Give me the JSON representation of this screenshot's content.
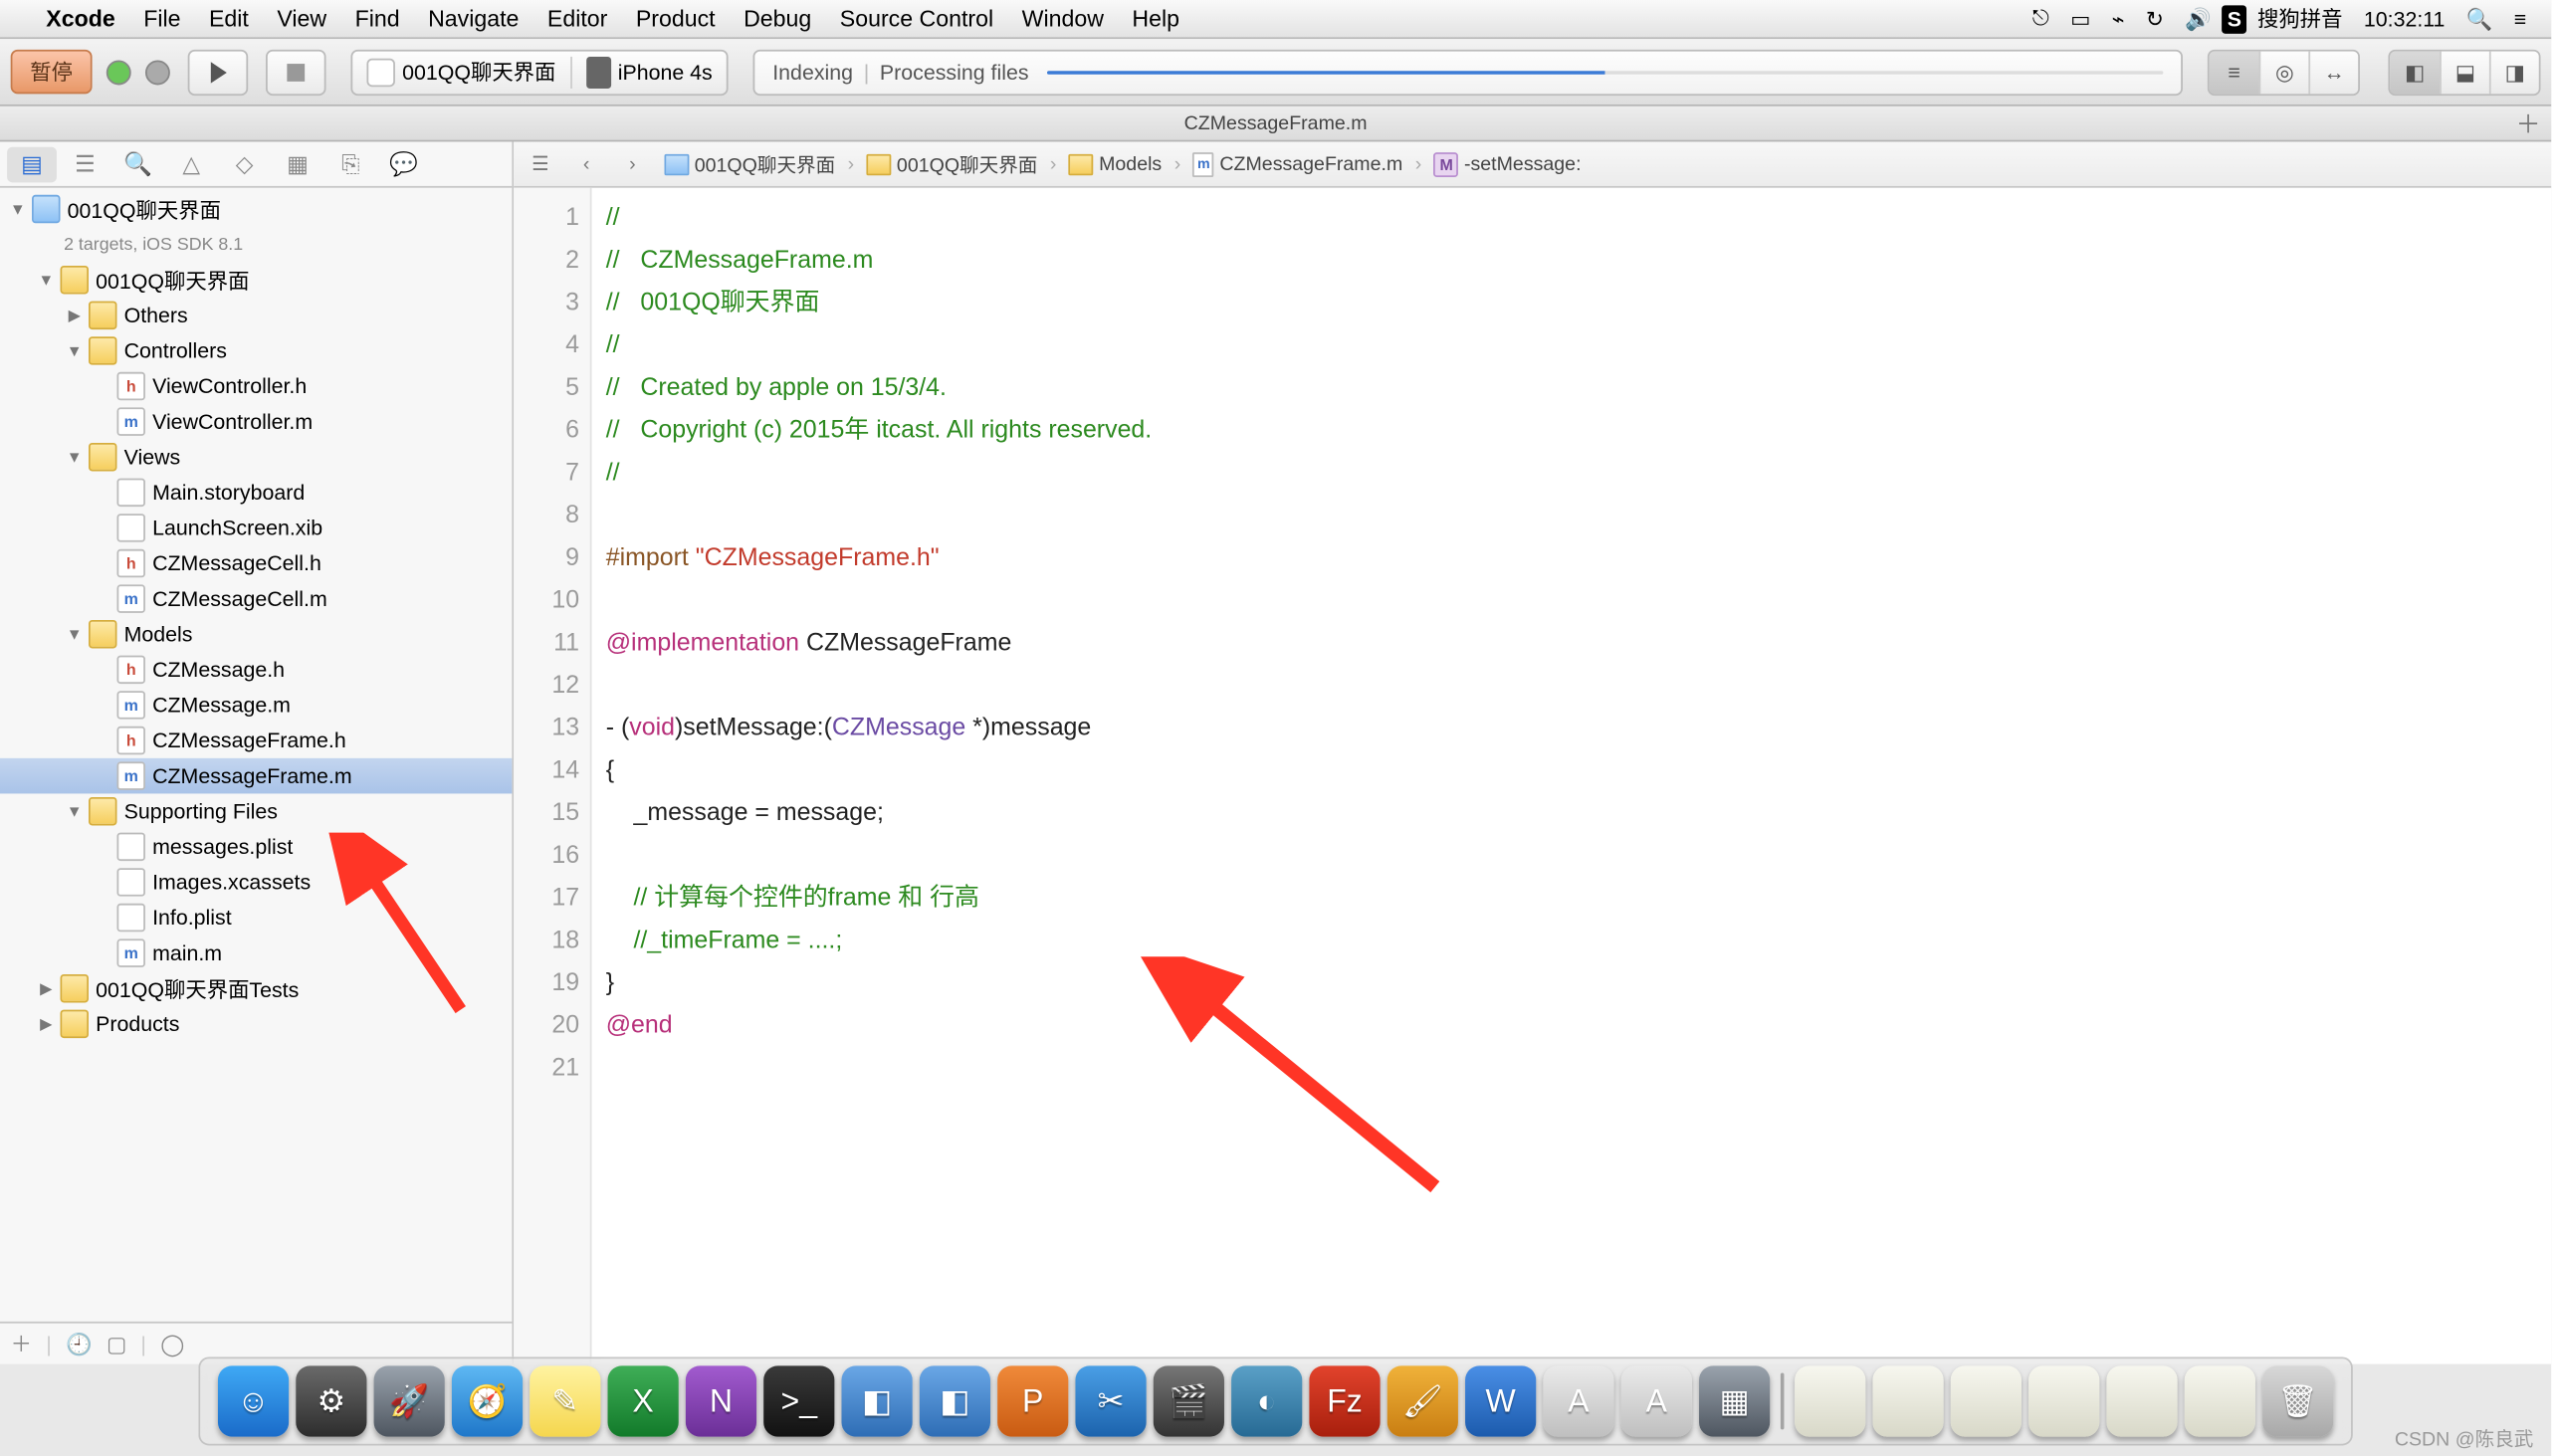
{
  "menu": {
    "appName": "Xcode",
    "items": [
      "File",
      "Edit",
      "View",
      "Find",
      "Navigate",
      "Editor",
      "Product",
      "Debug",
      "Source Control",
      "Window",
      "Help"
    ],
    "right": {
      "ime": "搜狗拼音",
      "time": "10:32:11"
    }
  },
  "toolbar": {
    "pause": "暂停",
    "scheme": {
      "app": "001QQ聊天界面",
      "device": "iPhone 4s"
    },
    "activity": {
      "status": "Indexing",
      "separator": "|",
      "sub": "Processing files"
    }
  },
  "tabbar": {
    "title": "CZMessageFrame.m"
  },
  "navigator": {
    "project": {
      "name": "001QQ聊天界面",
      "subtitle": "2 targets, iOS SDK 8.1"
    },
    "tree": [
      {
        "level": 0,
        "type": "project",
        "label": "001QQ聊天界面",
        "open": true,
        "subtitle": "2 targets, iOS SDK 8.1"
      },
      {
        "level": 1,
        "type": "folder-y",
        "label": "001QQ聊天界面",
        "open": true
      },
      {
        "level": 2,
        "type": "folder-y",
        "label": "Others",
        "open": false,
        "arrow": true
      },
      {
        "level": 2,
        "type": "folder-y",
        "label": "Controllers",
        "open": true
      },
      {
        "level": 3,
        "type": "h",
        "label": "ViewController.h"
      },
      {
        "level": 3,
        "type": "m",
        "label": "ViewController.m"
      },
      {
        "level": 2,
        "type": "folder-y",
        "label": "Views",
        "open": true
      },
      {
        "level": 3,
        "type": "xib",
        "label": "Main.storyboard"
      },
      {
        "level": 3,
        "type": "xib",
        "label": "LaunchScreen.xib"
      },
      {
        "level": 3,
        "type": "h",
        "label": "CZMessageCell.h"
      },
      {
        "level": 3,
        "type": "m",
        "label": "CZMessageCell.m"
      },
      {
        "level": 2,
        "type": "folder-y",
        "label": "Models",
        "open": true
      },
      {
        "level": 3,
        "type": "h",
        "label": "CZMessage.h"
      },
      {
        "level": 3,
        "type": "m",
        "label": "CZMessage.m"
      },
      {
        "level": 3,
        "type": "h",
        "label": "CZMessageFrame.h"
      },
      {
        "level": 3,
        "type": "m",
        "label": "CZMessageFrame.m",
        "selected": true
      },
      {
        "level": 2,
        "type": "folder-y",
        "label": "Supporting Files",
        "open": true
      },
      {
        "level": 3,
        "type": "xib",
        "label": "messages.plist"
      },
      {
        "level": 3,
        "type": "xib",
        "label": "Images.xcassets"
      },
      {
        "level": 3,
        "type": "xib",
        "label": "Info.plist"
      },
      {
        "level": 3,
        "type": "m",
        "label": "main.m"
      },
      {
        "level": 1,
        "type": "folder-y",
        "label": "001QQ聊天界面Tests",
        "open": false,
        "arrow": true
      },
      {
        "level": 1,
        "type": "folder-y",
        "label": "Products",
        "open": false,
        "arrow": true
      }
    ]
  },
  "jumpbar": {
    "items": [
      "001QQ聊天界面",
      "001QQ聊天界面",
      "Models",
      "CZMessageFrame.m",
      "-setMessage:"
    ]
  },
  "code": {
    "lines": [
      [
        {
          "c": "c-comment",
          "t": "//"
        }
      ],
      [
        {
          "c": "c-comment",
          "t": "//   CZMessageFrame.m"
        }
      ],
      [
        {
          "c": "c-comment",
          "t": "//   001QQ聊天界面"
        }
      ],
      [
        {
          "c": "c-comment",
          "t": "//"
        }
      ],
      [
        {
          "c": "c-comment",
          "t": "//   Created by apple on 15/3/4."
        }
      ],
      [
        {
          "c": "c-comment",
          "t": "//   Copyright (c) 2015年 itcast. All rights reserved."
        }
      ],
      [
        {
          "c": "c-comment",
          "t": "//"
        }
      ],
      [
        {
          "c": "c-plain",
          "t": ""
        }
      ],
      [
        {
          "c": "c-pre",
          "t": "#import "
        },
        {
          "c": "c-string",
          "t": "\"CZMessageFrame.h\""
        }
      ],
      [
        {
          "c": "c-plain",
          "t": ""
        }
      ],
      [
        {
          "c": "c-keyword",
          "t": "@implementation"
        },
        {
          "c": "c-plain",
          "t": " CZMessageFrame"
        }
      ],
      [
        {
          "c": "c-plain",
          "t": ""
        }
      ],
      [
        {
          "c": "c-plain",
          "t": "- ("
        },
        {
          "c": "c-keyword",
          "t": "void"
        },
        {
          "c": "c-plain",
          "t": ")setMessage:("
        },
        {
          "c": "c-type",
          "t": "CZMessage"
        },
        {
          "c": "c-plain",
          "t": " *)message"
        }
      ],
      [
        {
          "c": "c-plain",
          "t": "{"
        }
      ],
      [
        {
          "c": "c-plain",
          "t": "    _message = message;"
        }
      ],
      [
        {
          "c": "c-plain",
          "t": ""
        }
      ],
      [
        {
          "c": "c-plain",
          "t": "    "
        },
        {
          "c": "c-comment",
          "t": "// 计算每个控件的frame 和 行高"
        }
      ],
      [
        {
          "c": "c-plain",
          "t": "    "
        },
        {
          "c": "c-comment",
          "t": "//_timeFrame = ....;"
        }
      ],
      [
        {
          "c": "c-plain",
          "t": "}"
        }
      ],
      [
        {
          "c": "c-keyword",
          "t": "@end"
        }
      ],
      [
        {
          "c": "c-plain",
          "t": ""
        }
      ]
    ]
  },
  "dock": {
    "items": [
      {
        "name": "finder",
        "bg": "linear-gradient(#3fa9f5,#1a6bc9)",
        "glyph": "☺"
      },
      {
        "name": "settings",
        "bg": "linear-gradient(#6a6a6a,#2d2d2d)",
        "glyph": "⚙"
      },
      {
        "name": "launchpad",
        "bg": "linear-gradient(#9aa3ad,#4e5660)",
        "glyph": "🚀"
      },
      {
        "name": "safari",
        "bg": "linear-gradient(#5eb8f3,#1f77c9)",
        "glyph": "🧭"
      },
      {
        "name": "notes",
        "bg": "linear-gradient(#fff3a1,#f5d64e)",
        "glyph": "✎"
      },
      {
        "name": "excel",
        "bg": "linear-gradient(#3fae57,#127a2a)",
        "glyph": "X"
      },
      {
        "name": "onenote",
        "bg": "linear-gradient(#a25bcf,#6b2f97)",
        "glyph": "N"
      },
      {
        "name": "terminal",
        "bg": "linear-gradient(#3a3a3a,#111)",
        "glyph": ">_"
      },
      {
        "name": "app1",
        "bg": "linear-gradient(#6aa7e6,#2e6db5)",
        "glyph": "◧"
      },
      {
        "name": "app2",
        "bg": "linear-gradient(#6aa7e6,#2e6db5)",
        "glyph": "◧"
      },
      {
        "name": "ppt",
        "bg": "linear-gradient(#f08a3a,#c95b12)",
        "glyph": "P"
      },
      {
        "name": "screenshot",
        "bg": "linear-gradient(#4a9fe6,#1c63ad)",
        "glyph": "✂"
      },
      {
        "name": "movie",
        "bg": "linear-gradient(#777,#333)",
        "glyph": "🎬"
      },
      {
        "name": "app3",
        "bg": "linear-gradient(#5aa0c7,#276a94)",
        "glyph": "◐"
      },
      {
        "name": "filezilla",
        "bg": "linear-gradient(#e2432c,#a81f0d)",
        "glyph": "Fz"
      },
      {
        "name": "paint",
        "bg": "linear-gradient(#f0b23a,#c97e12)",
        "glyph": "🖌"
      },
      {
        "name": "word",
        "bg": "linear-gradient(#4a8fe6,#1c5bad)",
        "glyph": "W"
      },
      {
        "name": "xcode1",
        "bg": "linear-gradient(#eaeaea,#bfbfbf)",
        "glyph": "A"
      },
      {
        "name": "xcode2",
        "bg": "linear-gradient(#eaeaea,#bfbfbf)",
        "glyph": "A"
      },
      {
        "name": "app4",
        "bg": "linear-gradient(#9aa3ad,#4e5660)",
        "glyph": "▦"
      },
      {
        "name": "sep"
      },
      {
        "name": "doc1",
        "bg": "linear-gradient(#f7f7ef,#d8d8c8)",
        "glyph": ""
      },
      {
        "name": "doc2",
        "bg": "linear-gradient(#f7f7ef,#d8d8c8)",
        "glyph": ""
      },
      {
        "name": "doc3",
        "bg": "linear-gradient(#f7f7ef,#d8d8c8)",
        "glyph": ""
      },
      {
        "name": "doc4",
        "bg": "linear-gradient(#f7f7ef,#d8d8c8)",
        "glyph": ""
      },
      {
        "name": "doc5",
        "bg": "linear-gradient(#f7f7ef,#d8d8c8)",
        "glyph": ""
      },
      {
        "name": "doc6",
        "bg": "linear-gradient(#f7f7ef,#d8d8c8)",
        "glyph": ""
      },
      {
        "name": "trash",
        "bg": "linear-gradient(#d8d8d8,#a8a8a8)",
        "glyph": "🗑"
      }
    ]
  },
  "watermark": "CSDN @陈良武"
}
